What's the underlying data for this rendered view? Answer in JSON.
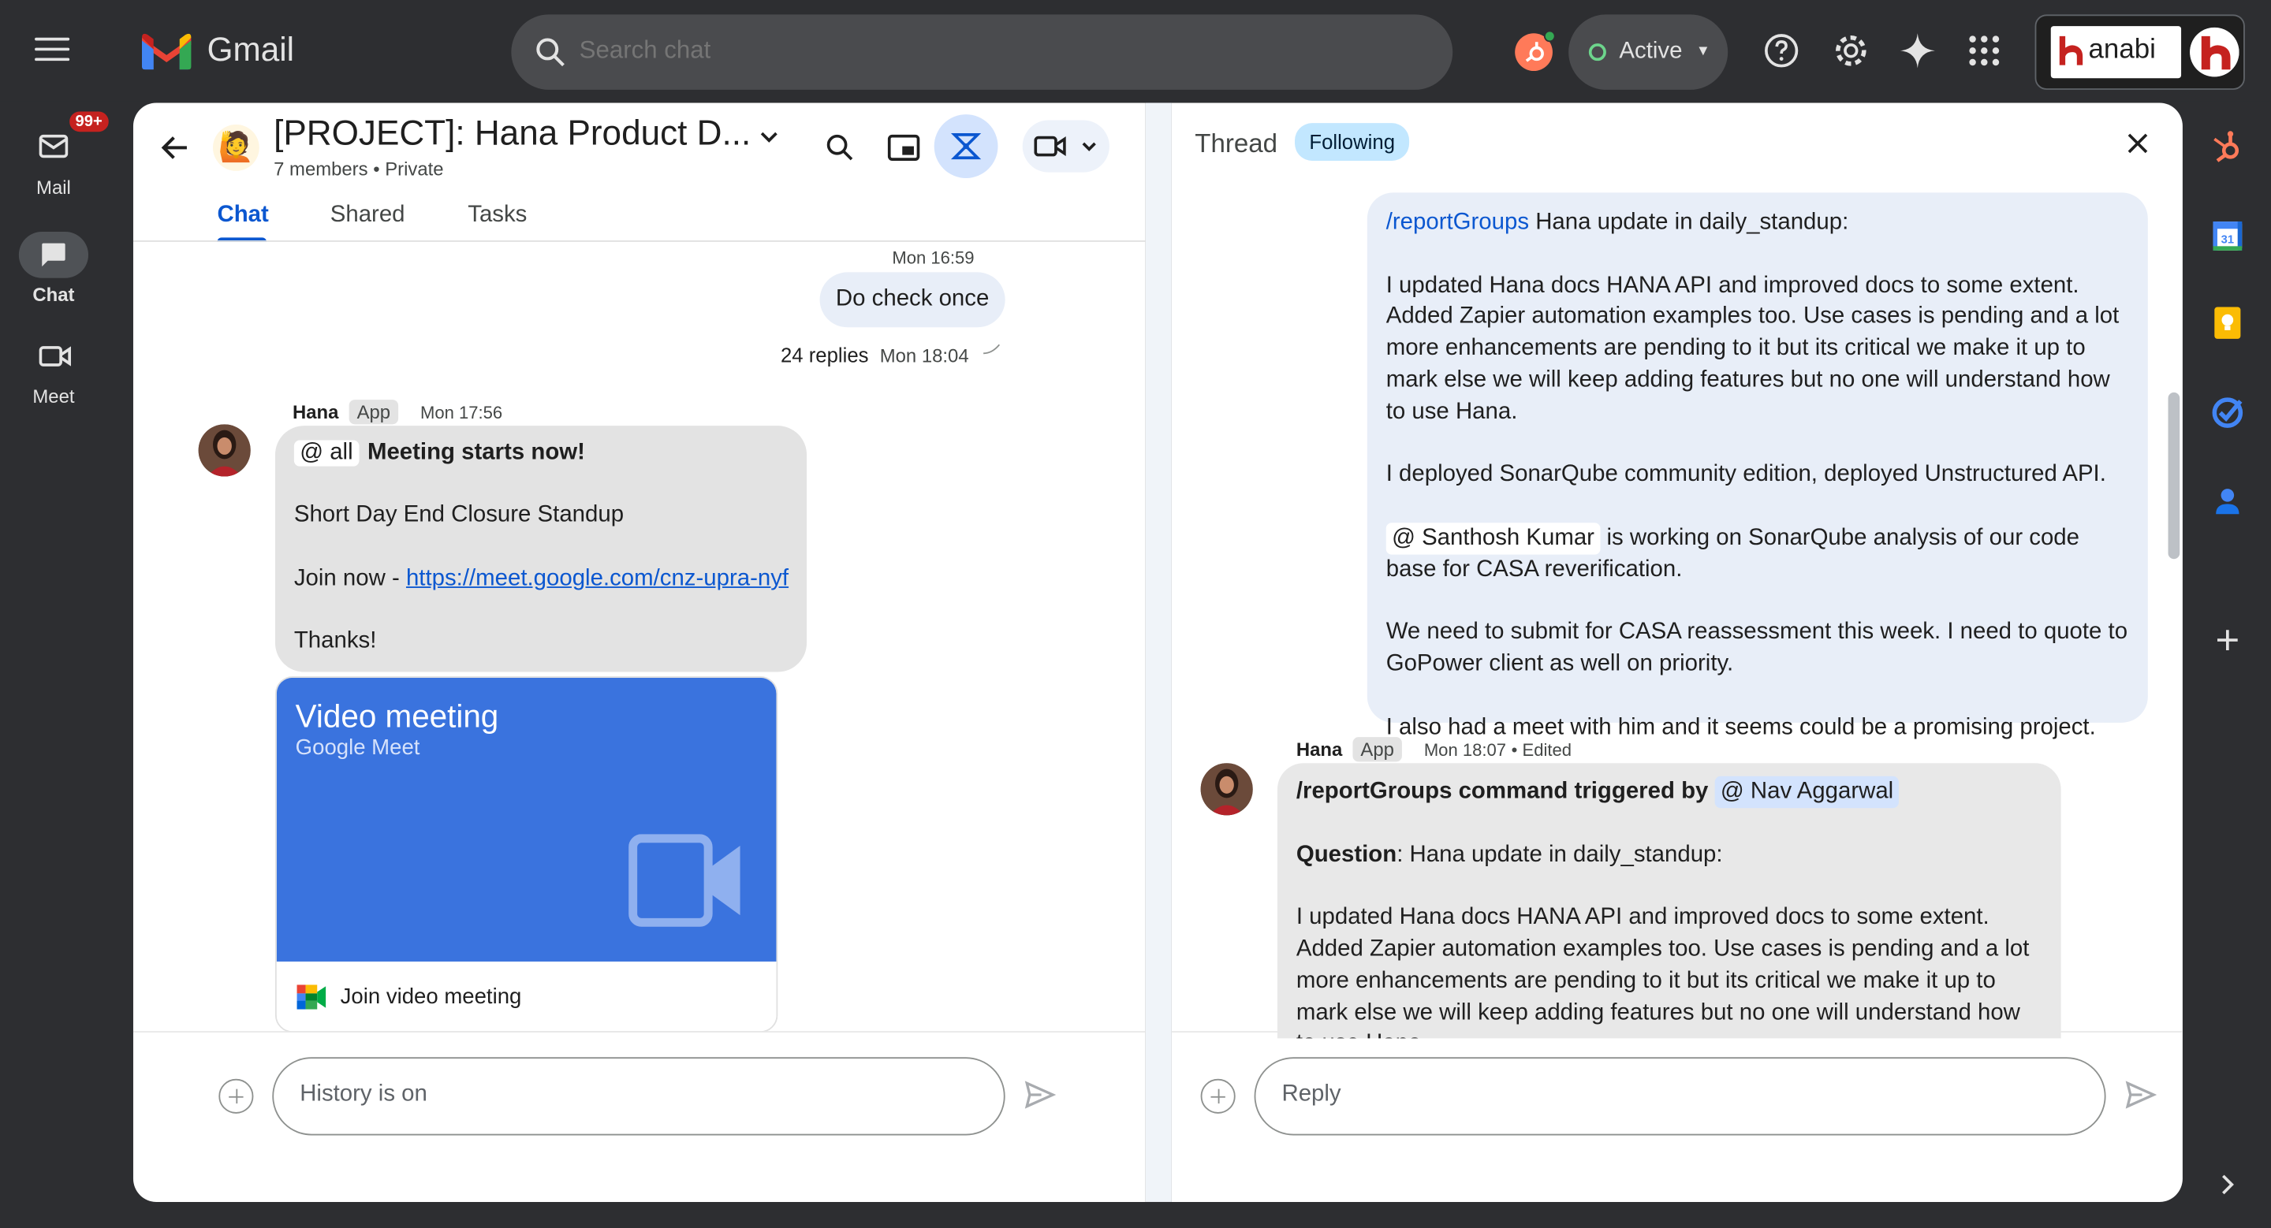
{
  "app": {
    "name": "Gmail"
  },
  "search": {
    "placeholder": "Search chat"
  },
  "status": {
    "label": "Active",
    "color": "#6dd58c"
  },
  "account": {
    "brand": "anabi"
  },
  "rail": {
    "mail": {
      "label": "Mail",
      "badge": "99+"
    },
    "chat": {
      "label": "Chat"
    },
    "meet": {
      "label": "Meet"
    }
  },
  "space": {
    "emoji": "🙋",
    "title": "[PROJECT]: Hana Product D...",
    "members": "7 members",
    "privacy": "Private",
    "tabs": [
      "Chat",
      "Shared",
      "Tasks"
    ]
  },
  "messages": {
    "self": {
      "time": "Mon 16:59",
      "text": "Do check once",
      "replies": "24 replies",
      "replies_time": "Mon 18:04"
    },
    "hana": {
      "sender": "Hana",
      "tag": "App",
      "time": "Mon 17:56",
      "mention": "@ all",
      "headline": "Meeting starts now!",
      "line1": "Short Day End Closure Standup",
      "join_prefix": "Join now - ",
      "join_link": "https://meet.google.com/cnz-upra-nyf",
      "thanks": "Thanks!",
      "card_title": "Video meeting",
      "card_sub": "Google Meet",
      "card_join": "Join video meeting"
    }
  },
  "composer_left": {
    "placeholder": "History is on"
  },
  "thread": {
    "title": "Thread",
    "following": "Following",
    "self_msg": {
      "cmd": "/reportGroups",
      "cmd_rest": " Hana update in daily_standup:",
      "p1": "I updated Hana docs HANA API and improved docs to some extent. Added Zapier automation examples too. Use cases is pending and a lot more enhancements are pending to it but its critical we make it up to mark else we will keep adding features but no one will understand how to use Hana.",
      "p2": "I deployed SonarQube community edition, deployed Unstructured API.",
      "mention": "@ Santhosh Kumar",
      "p3_rest": " is working on SonarQube analysis of our code base for CASA reverification.",
      "p4": "We need to submit for CASA reassessment this week. I need to quote to GoPower client as well on priority.",
      "p5": "I also had a meet with him and it seems could be a promising project."
    },
    "hana_msg": {
      "sender": "Hana",
      "tag": "App",
      "time": "Mon 18:07",
      "edited": "Edited",
      "line1_bold": "/reportGroups command triggered by",
      "mention": "@ Nav Aggarwal",
      "q_bold": "Question",
      "q_rest": ": Hana update in daily_standup:",
      "p1": "I updated Hana docs HANA API and improved docs to some extent. Added Zapier automation examples too. Use cases is pending and a lot more enhancements are pending to it but its critical we make it up to mark else we will keep adding features but no one will understand how to use Hana."
    }
  },
  "composer_right": {
    "placeholder": "Reply"
  },
  "icons": [
    "menu-icon",
    "search-icon",
    "help-icon",
    "settings-icon",
    "gemini-icon",
    "apps-icon",
    "back-icon",
    "pip-icon",
    "integrations-icon",
    "video-icon",
    "close-icon",
    "send-icon",
    "hubspot-icon",
    "calendar-icon",
    "keep-icon",
    "tasks-icon",
    "contacts-icon",
    "add-icon",
    "chevron-right-icon"
  ]
}
